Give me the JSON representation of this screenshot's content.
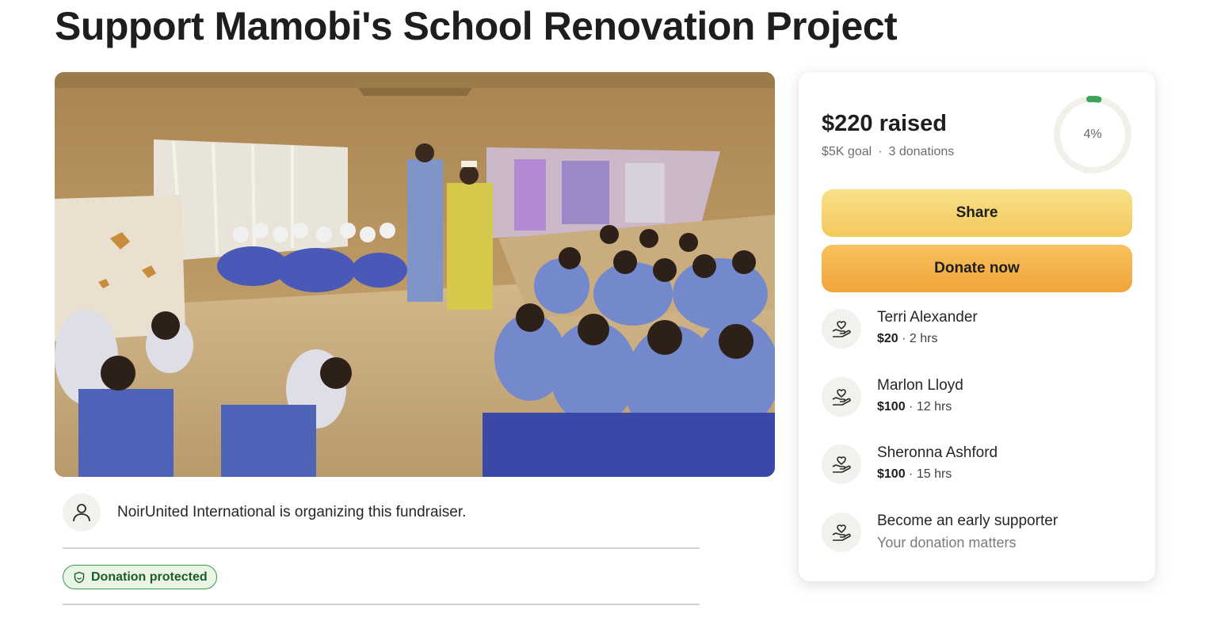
{
  "campaign": {
    "title": "Support Mamobi's School Renovation Project",
    "organizer_text": "NoirUnited International is organizing this fundraiser.",
    "protected_badge": "Donation protected"
  },
  "stats": {
    "raised": "$220 raised",
    "goal": "$5K goal",
    "separator": "·",
    "donations": "3 donations",
    "percent_label": "4%",
    "progress_fraction": 0.04
  },
  "actions": {
    "share_label": "Share",
    "donate_label": "Donate now"
  },
  "donations": [
    {
      "name": "Terri Alexander",
      "amount": "$20",
      "time": "· 2 hrs"
    },
    {
      "name": "Marlon Lloyd",
      "amount": "$100",
      "time": "· 12 hrs"
    },
    {
      "name": "Sheronna Ashford",
      "amount": "$100",
      "time": "· 15 hrs"
    }
  ],
  "early_supporter": {
    "title": "Become an early supporter",
    "subtitle": "Your donation matters"
  },
  "colors": {
    "progress": "#3aa555",
    "progress_track": "#f1f1ea",
    "share_button": "#f3c95c",
    "donate_button": "#f0a53a",
    "badge_green": "#3a9a4a"
  }
}
